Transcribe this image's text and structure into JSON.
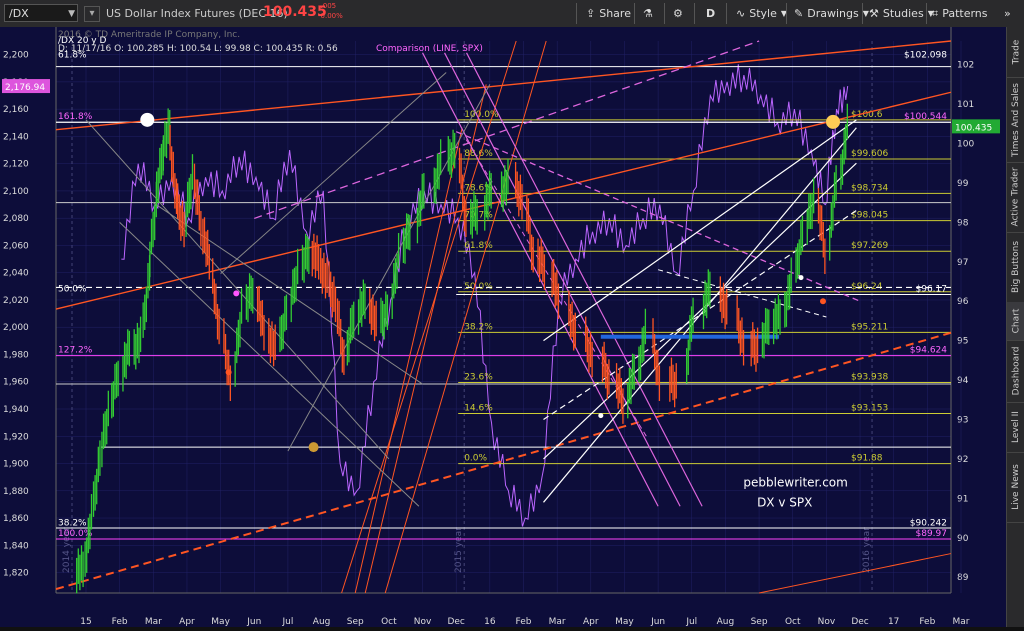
{
  "toolbar": {
    "symbol": "/DX",
    "title": "US Dollar Index Futures (DEC 16)",
    "price": "100.435",
    "change_line1": "-.005",
    "change_line2": "-0.00%",
    "share": "Share",
    "period_letter": "D",
    "style": "Style",
    "drawings": "Drawings",
    "studies": "Studies",
    "patterns": "Patterns"
  },
  "right_tabs": [
    "Trade",
    "Times And Sales",
    "Active Trader",
    "Big Buttons",
    "Chart",
    "Dashboard",
    "Level II",
    "Live News"
  ],
  "colors": {
    "background": "#0d0d3a",
    "candle_up": "#33cc33",
    "candle_down": "#ff5522",
    "spx": "#bb66ff",
    "fib": "#cccc33",
    "trend_orange": "#ff5522",
    "trend_pink": "#dd66dd",
    "trend_white": "#ffffff",
    "trend_gray": "#888888"
  },
  "chart_data": {
    "type": "line",
    "header": {
      "study_title": "/DX 20 y D",
      "ohlc": "D: 11/17/16   O: 100.285   H: 100.54   L: 99.98   C: 100.435   R: 0.56",
      "comparison": "Comparison (LINE, SPX)",
      "copyright": "2016 © TD Ameritrade IP Company, Inc."
    },
    "x_tick_labels": [
      "15",
      "Feb",
      "Mar",
      "Apr",
      "May",
      "Jun",
      "Jul",
      "Aug",
      "Sep",
      "Oct",
      "Nov",
      "Dec",
      "16",
      "Feb",
      "Mar",
      "Apr",
      "May",
      "Jun",
      "Jul",
      "Aug",
      "Sep",
      "Oct",
      "Nov",
      "Dec",
      "17",
      "Feb",
      "Mar"
    ],
    "left_axis": {
      "label": "SPX",
      "ticks": [
        1820,
        1840,
        1860,
        1880,
        1900,
        1920,
        1940,
        1960,
        1980,
        2000,
        2020,
        2040,
        2060,
        2080,
        2100,
        2120,
        2140,
        2160,
        2180,
        2200
      ],
      "ylim": [
        1805,
        2210
      ],
      "current": "2,176.94"
    },
    "right_axis": {
      "label": "DX",
      "ticks": [
        89,
        90,
        91,
        92,
        93,
        94,
        95,
        96,
        97,
        98,
        99,
        100,
        101,
        102
      ],
      "ylim": [
        88.6,
        102.6
      ],
      "current": "100.435"
    },
    "series": [
      {
        "name": "/DX",
        "kind": "candles",
        "points": [
          [
            "15",
            89.2
          ],
          [
            "15",
            90.5
          ],
          [
            "15",
            92.1
          ],
          [
            "15",
            93.2
          ],
          [
            "Feb",
            94.2
          ],
          [
            "Feb",
            94.8
          ],
          [
            "Feb",
            95.0
          ],
          [
            "Mar",
            96.8
          ],
          [
            "Mar",
            98.5
          ],
          [
            "Mar",
            99.8
          ],
          [
            "Mar",
            100.4
          ],
          [
            "Mar",
            98.5
          ],
          [
            "Apr",
            97.9
          ],
          [
            "Apr",
            99.2
          ],
          [
            "Apr",
            98.0
          ],
          [
            "Apr",
            97.0
          ],
          [
            "May",
            95.2
          ],
          [
            "May",
            94.0
          ],
          [
            "May",
            95.8
          ],
          [
            "Jun",
            96.3
          ],
          [
            "Jun",
            95.2
          ],
          [
            "Jun",
            94.8
          ],
          [
            "Jul",
            95.8
          ],
          [
            "Jul",
            96.8
          ],
          [
            "Jul",
            97.3
          ],
          [
            "Aug",
            97.0
          ],
          [
            "Aug",
            96.5
          ],
          [
            "Aug",
            96.0
          ],
          [
            "Aug",
            94.5
          ],
          [
            "Sep",
            95.7
          ],
          [
            "Sep",
            96.0
          ],
          [
            "Sep",
            95.4
          ],
          [
            "Oct",
            95.8
          ],
          [
            "Oct",
            97.2
          ],
          [
            "Oct",
            97.9
          ],
          [
            "Nov",
            98.8
          ],
          [
            "Nov",
            99.5
          ],
          [
            "Dec",
            99.9
          ],
          [
            "Dec",
            98.0
          ],
          [
            "Dec",
            98.3
          ],
          [
            "16",
            98.8
          ],
          [
            "16",
            99.0
          ],
          [
            "Feb",
            98.6
          ],
          [
            "Feb",
            97.1
          ],
          [
            "Feb",
            96.9
          ],
          [
            "Mar",
            96.0
          ],
          [
            "Mar",
            95.1
          ],
          [
            "Apr",
            94.6
          ],
          [
            "Apr",
            94.0
          ],
          [
            "May",
            93.5
          ],
          [
            "May",
            94.2
          ],
          [
            "May",
            95.2
          ],
          [
            "Jun",
            94.0
          ],
          [
            "Jun",
            93.9
          ],
          [
            "Jul",
            95.8
          ],
          [
            "Jul",
            96.3
          ],
          [
            "Aug",
            95.7
          ],
          [
            "Aug",
            94.9
          ],
          [
            "Sep",
            94.8
          ],
          [
            "Sep",
            95.5
          ],
          [
            "Sep",
            95.6
          ],
          [
            "Oct",
            96.5
          ],
          [
            "Oct",
            97.8
          ],
          [
            "Oct",
            98.6
          ],
          [
            "Nov",
            97.3
          ],
          [
            "Nov",
            99.0
          ],
          [
            "Nov",
            100.4
          ]
        ]
      },
      {
        "name": "SPX",
        "kind": "line",
        "points": [
          [
            "Feb",
            2050
          ],
          [
            "Feb",
            2120
          ],
          [
            "Mar",
            2090
          ],
          [
            "Mar",
            2110
          ],
          [
            "Apr",
            2080
          ],
          [
            "Apr",
            2110
          ],
          [
            "May",
            2100
          ],
          [
            "May",
            2125
          ],
          [
            "Jun",
            2110
          ],
          [
            "Jun",
            2080
          ],
          [
            "Jul",
            2130
          ],
          [
            "Jul",
            2070
          ],
          [
            "Aug",
            2100
          ],
          [
            "Aug",
            1900
          ],
          [
            "Sep",
            1880
          ],
          [
            "Sep",
            1960
          ],
          [
            "Oct",
            2020
          ],
          [
            "Oct",
            2080
          ],
          [
            "Nov",
            2100
          ],
          [
            "Nov",
            2090
          ],
          [
            "Dec",
            2080
          ],
          [
            "Dec",
            2040
          ],
          [
            "16",
            1930
          ],
          [
            "16",
            1880
          ],
          [
            "Feb",
            1860
          ],
          [
            "Feb",
            1890
          ],
          [
            "Mar",
            2020
          ],
          [
            "Mar",
            2050
          ],
          [
            "Apr",
            2070
          ],
          [
            "Apr",
            2080
          ],
          [
            "May",
            2060
          ],
          [
            "May",
            2080
          ],
          [
            "Jun",
            2090
          ],
          [
            "Jun",
            2040
          ],
          [
            "Jul",
            2100
          ],
          [
            "Jul",
            2170
          ],
          [
            "Aug",
            2180
          ],
          [
            "Aug",
            2185
          ],
          [
            "Sep",
            2170
          ],
          [
            "Sep",
            2150
          ],
          [
            "Oct",
            2160
          ],
          [
            "Oct",
            2130
          ],
          [
            "Nov",
            2090
          ],
          [
            "Nov",
            2160
          ],
          [
            "Nov",
            2176.94
          ]
        ]
      }
    ],
    "fib_levels": [
      {
        "pct": "100.0%",
        "value": "$100.6"
      },
      {
        "pct": "88.6%",
        "value": "$99.606"
      },
      {
        "pct": "78.6%",
        "value": "$98.734"
      },
      {
        "pct": "70.7%",
        "value": "$98.045"
      },
      {
        "pct": "61.8%",
        "value": "$97.269"
      },
      {
        "pct": "50.0%",
        "value": "$96.24"
      },
      {
        "pct": "38.2%",
        "value": "$95.211"
      },
      {
        "pct": "23.6%",
        "value": "$93.938"
      },
      {
        "pct": "14.6%",
        "value": "$93.153"
      },
      {
        "pct": "0.0%",
        "value": "$91.88"
      }
    ],
    "fib_prices": [
      100.6,
      99.606,
      98.734,
      98.045,
      97.269,
      96.24,
      95.211,
      93.938,
      93.153,
      91.88
    ],
    "side_levels": [
      {
        "label": "$102.098",
        "value": 102.1
      },
      {
        "label": "$100.544",
        "value": 100.544
      },
      {
        "label": "$96.17",
        "value": 96.17
      },
      {
        "label": "$94.624",
        "value": 94.624
      },
      {
        "label": "$90.242",
        "value": 90.242
      },
      {
        "label": "$89.97",
        "value": 89.97
      }
    ],
    "left_fib_labels": [
      {
        "pct": "61.8%",
        "value": 102.1
      },
      {
        "pct": "161.8%",
        "value": 100.54
      },
      {
        "pct": "50.0%",
        "value": 96.17
      },
      {
        "pct": "127.2%",
        "value": 94.62
      },
      {
        "pct": "38.2%",
        "value": 90.24
      },
      {
        "pct": "100.0%",
        "value": 89.97
      }
    ],
    "annotations": {
      "watermark_line1": "pebblewriter.com",
      "watermark_line2": "DX v SPX",
      "year_2014": "2014 year",
      "year_2015": "2015 year",
      "year_2016": "2016 year"
    },
    "grid": true,
    "legend": "top-left"
  }
}
